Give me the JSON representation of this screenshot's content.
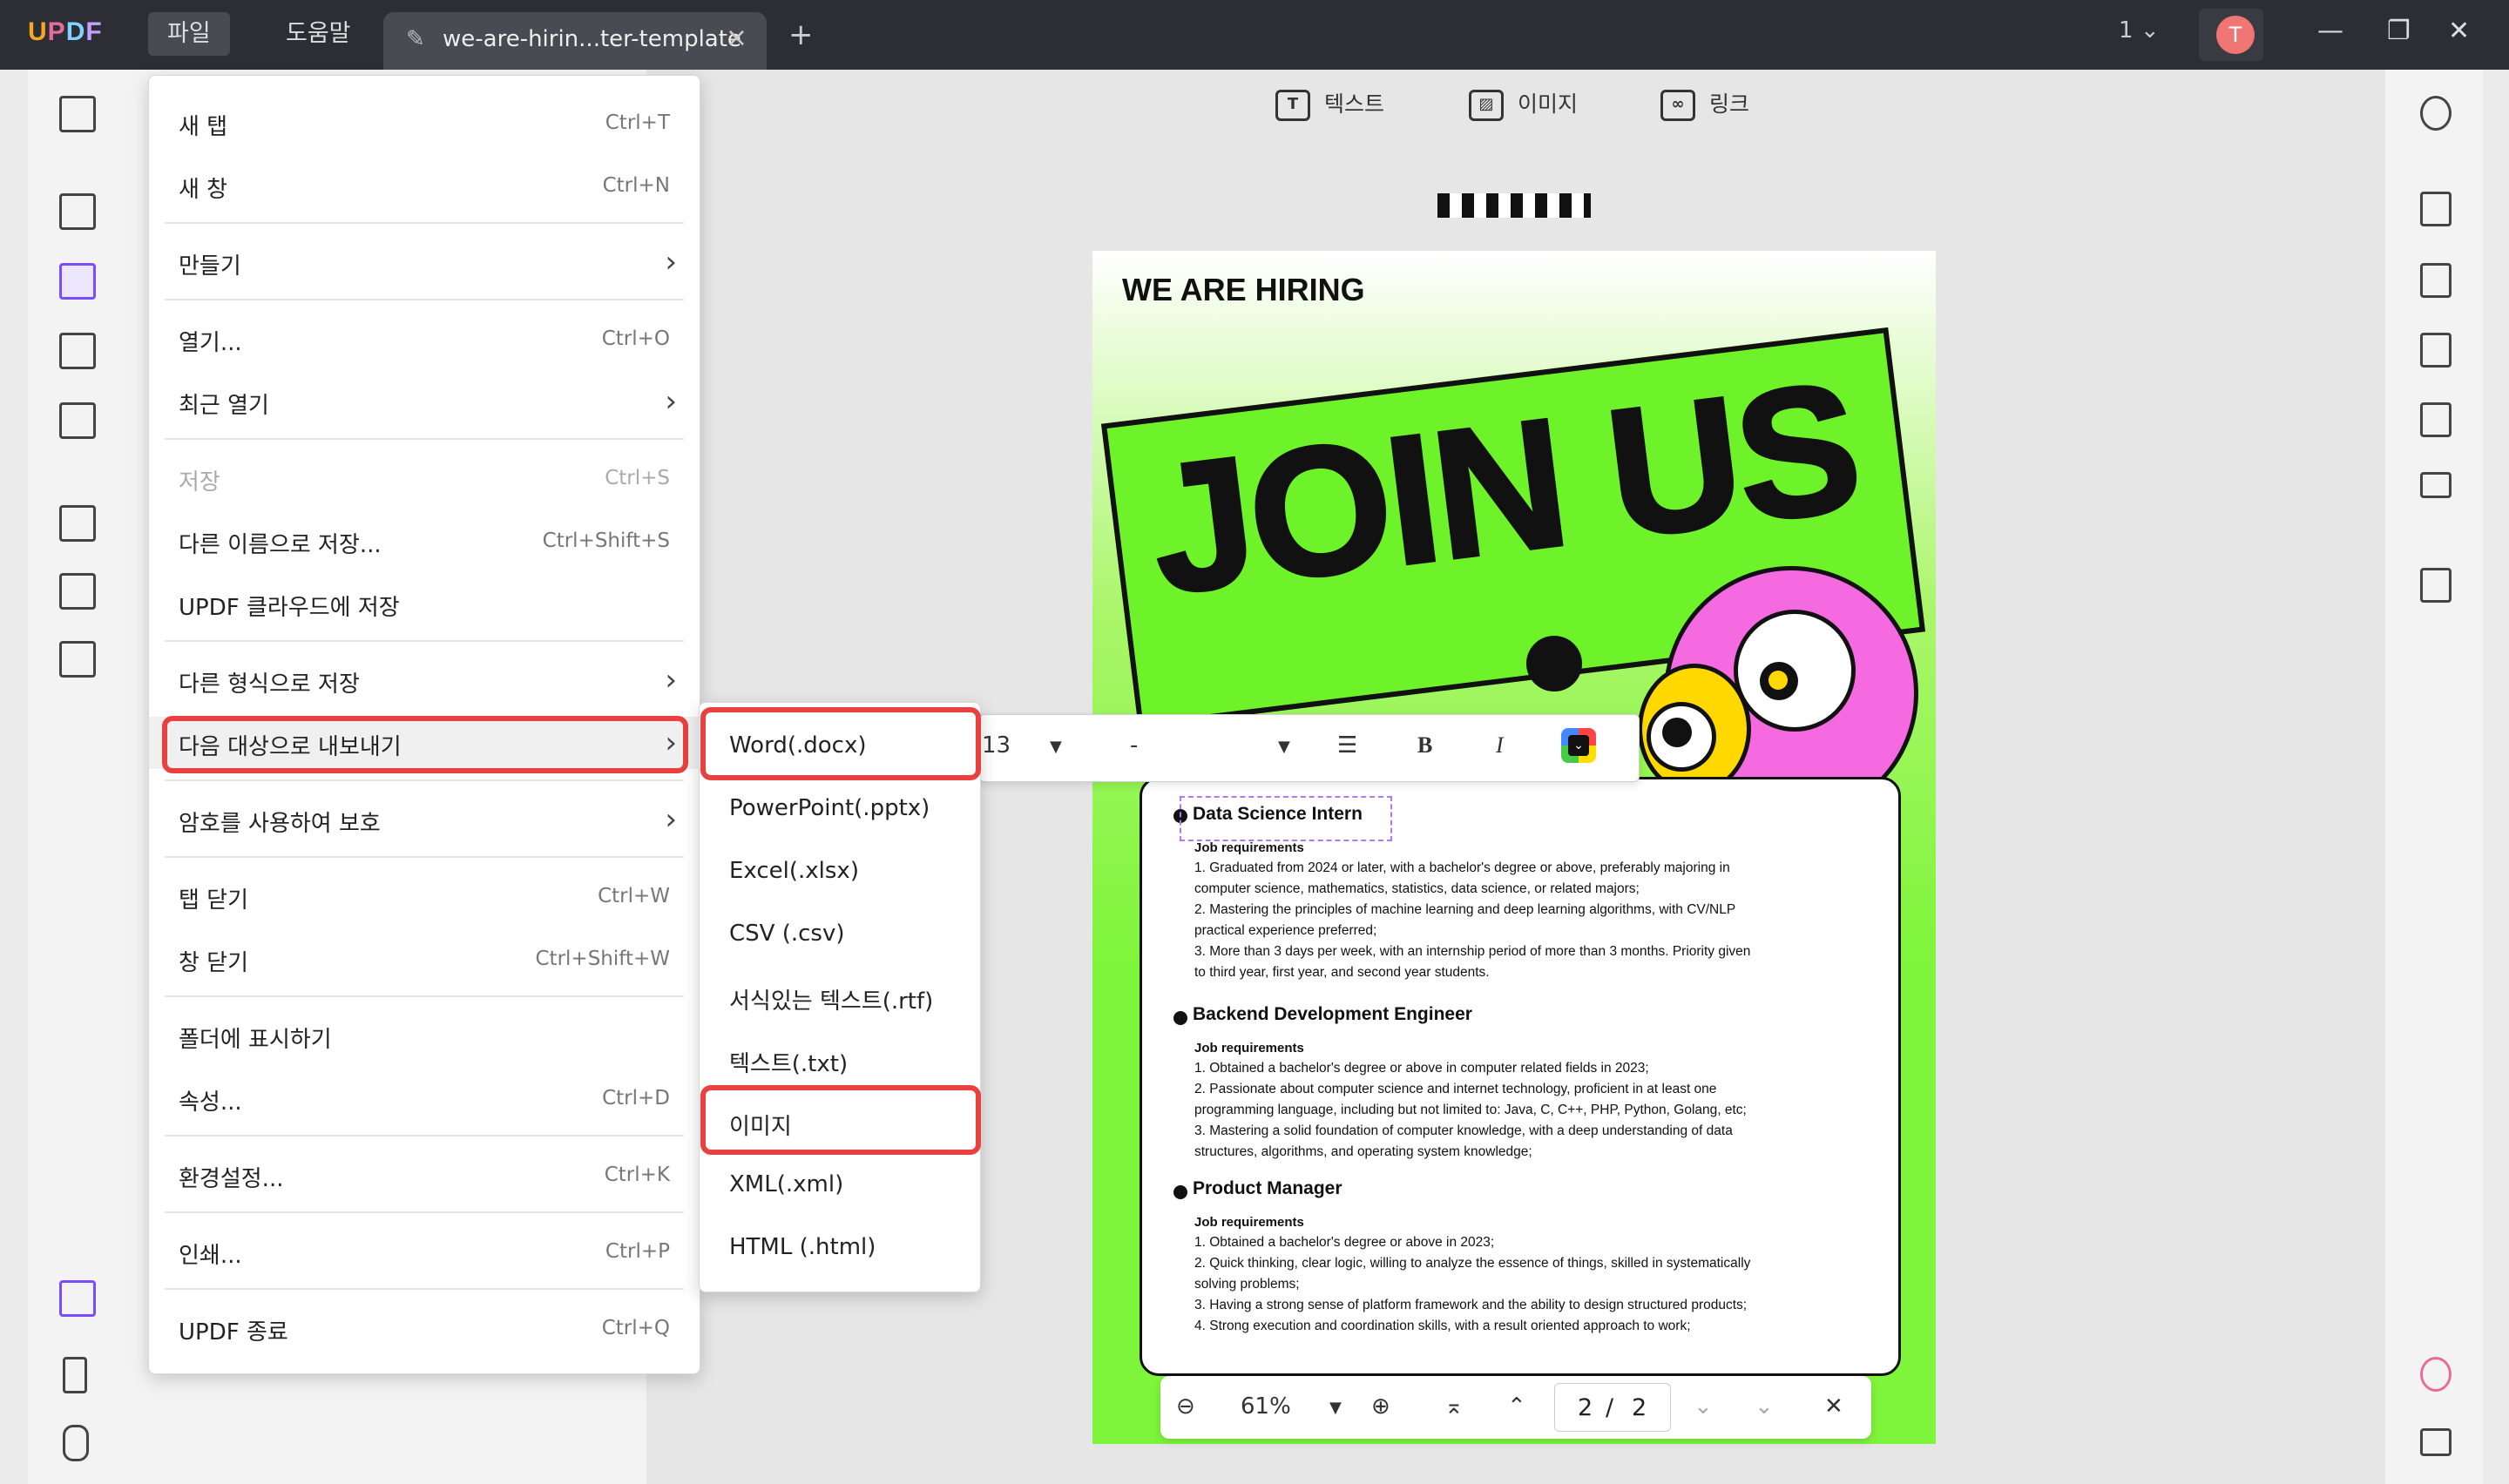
{
  "app": {
    "logo": "UPDF",
    "menus": [
      "파일",
      "도움말"
    ],
    "tab_title": "we-are-hirin...ter-template",
    "page_indicator": "1",
    "avatar_initial": "T"
  },
  "toolbar": {
    "text": "텍스트",
    "image": "이미지",
    "link": "링크"
  },
  "file_menu": [
    {
      "label": "새 탭",
      "shortcut": "Ctrl+T"
    },
    {
      "label": "새 창",
      "shortcut": "Ctrl+N"
    },
    {
      "label": "만들기",
      "shortcut": ""
    },
    {
      "label": "열기...",
      "shortcut": "Ctrl+O"
    },
    {
      "label": "최근 열기",
      "shortcut": ""
    },
    {
      "label": "저장",
      "shortcut": "Ctrl+S"
    },
    {
      "label": "다른 이름으로 저장...",
      "shortcut": "Ctrl+Shift+S"
    },
    {
      "label": "UPDF 클라우드에 저장",
      "shortcut": ""
    },
    {
      "label": "다른 형식으로 저장",
      "shortcut": ""
    },
    {
      "label": "다음 대상으로 내보내기",
      "shortcut": ""
    },
    {
      "label": "암호를 사용하여 보호",
      "shortcut": ""
    },
    {
      "label": "탭 닫기",
      "shortcut": "Ctrl+W"
    },
    {
      "label": "창 닫기",
      "shortcut": "Ctrl+Shift+W"
    },
    {
      "label": "폴더에 표시하기",
      "shortcut": ""
    },
    {
      "label": "속성...",
      "shortcut": "Ctrl+D"
    },
    {
      "label": "환경설정...",
      "shortcut": "Ctrl+K"
    },
    {
      "label": "인쇄...",
      "shortcut": "Ctrl+P"
    },
    {
      "label": "UPDF 종료",
      "shortcut": "Ctrl+Q"
    }
  ],
  "export_menu": [
    "Word(.docx)",
    "PowerPoint(.pptx)",
    "Excel(.xlsx)",
    "CSV (.csv)",
    "서식있는 텍스트(.rtf)",
    "텍스트(.txt)",
    "이미지",
    "XML(.xml)",
    "HTML (.html)"
  ],
  "format_bar": {
    "font_size": "13",
    "font_name": "-",
    "bold": "B",
    "italic": "I"
  },
  "document": {
    "heading": "WE ARE HIRING",
    "banner": "JOIN US",
    "jobs": [
      {
        "title": "Data Science Intern",
        "req": "Job requirements",
        "lines": [
          "1. Graduated from 2024 or later, with a bachelor's degree or above, preferably majoring in",
          "computer science, mathematics, statistics, data science, or related majors;",
          "2. Mastering the principles of machine learning and deep learning algorithms, with CV/NLP",
          "practical experience preferred;",
          "3. More than 3 days per week, with an internship period of more than 3 months. Priority given",
          "to third year, first year, and second year students."
        ]
      },
      {
        "title": "Backend Development Engineer",
        "req": "Job requirements",
        "lines": [
          "1. Obtained a bachelor's degree or above in computer related fields in 2023;",
          "2. Passionate about computer science and internet technology, proficient in at least one",
          "programming language, including but not limited to: Java, C, C++, PHP, Python, Golang, etc;",
          "3. Mastering a solid foundation of computer knowledge, with a deep understanding of data",
          "structures, algorithms, and operating system knowledge;"
        ]
      },
      {
        "title": "Product Manager",
        "req": "Job requirements",
        "lines": [
          "1. Obtained a bachelor's degree or above in 2023;",
          "2. Quick thinking, clear logic, willing to analyze the essence of things, skilled in systematically",
          "solving problems;",
          "3. Having a strong sense of platform framework and the ability to design structured products;",
          "4. Strong execution and coordination skills, with a result oriented approach to work;"
        ]
      }
    ]
  },
  "zoom": {
    "level": "61%",
    "current_page": "2",
    "separator": "/",
    "total_pages": "2"
  },
  "colors": {
    "accent_red": "#e8413f",
    "titlebar": "#2d2d35",
    "poster_green": "#7ef53a"
  }
}
